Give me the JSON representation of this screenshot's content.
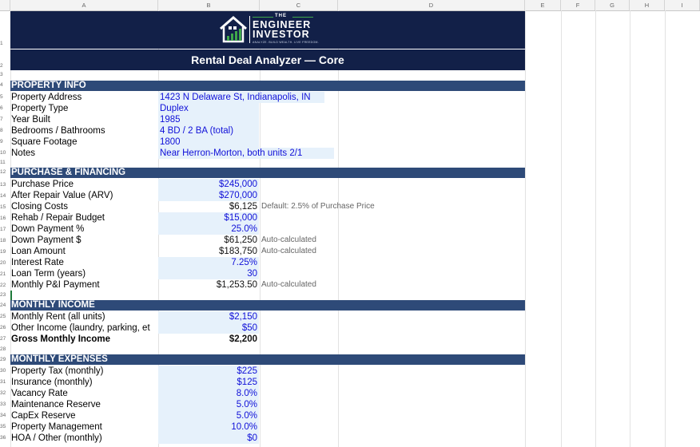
{
  "columns": [
    "A",
    "B",
    "C",
    "D",
    "E",
    "F",
    "G",
    "H",
    "I"
  ],
  "rows": [
    "1",
    "2",
    "3",
    "4",
    "5",
    "6",
    "7",
    "8",
    "9",
    "10",
    "11",
    "12",
    "13",
    "14",
    "15",
    "16",
    "17",
    "18",
    "19",
    "20",
    "21",
    "22",
    "23",
    "24",
    "25",
    "26",
    "27",
    "28",
    "29",
    "30",
    "31",
    "32",
    "33",
    "34",
    "35",
    "36"
  ],
  "logo": {
    "top": "THE",
    "line1": "ENGINEER",
    "line2": "INVESTOR",
    "tagline": "ANALYZE. BUILD WEALTH. LIVE FREEDOM."
  },
  "title": "Rental Deal Analyzer — Core",
  "property": {
    "header": "PROPERTY INFO",
    "rows": [
      {
        "label": "Property Address",
        "value": "1423 N Delaware St, Indianapolis, IN"
      },
      {
        "label": "Property Type",
        "value": "Duplex"
      },
      {
        "label": "Year Built",
        "value": "1985"
      },
      {
        "label": "Bedrooms / Bathrooms",
        "value": "4 BD / 2 BA (total)"
      },
      {
        "label": "Square Footage",
        "value": "1800"
      },
      {
        "label": "Notes",
        "value": "Near Herron-Morton, both units 2/1"
      }
    ]
  },
  "financing": {
    "header": "PURCHASE & FINANCING",
    "rows": [
      {
        "label": "Purchase Price",
        "value": "$245,000",
        "kind": "input",
        "note": ""
      },
      {
        "label": "After Repair Value (ARV)",
        "value": "$270,000",
        "kind": "input",
        "note": ""
      },
      {
        "label": "Closing Costs",
        "value": "$6,125",
        "kind": "calc",
        "note": "Default: 2.5% of Purchase Price"
      },
      {
        "label": "Rehab / Repair Budget",
        "value": "$15,000",
        "kind": "input",
        "note": ""
      },
      {
        "label": "Down Payment %",
        "value": "25.0%",
        "kind": "input",
        "note": ""
      },
      {
        "label": "Down Payment $",
        "value": "$61,250",
        "kind": "calc",
        "note": "Auto-calculated"
      },
      {
        "label": "Loan Amount",
        "value": "$183,750",
        "kind": "calc",
        "note": "Auto-calculated"
      },
      {
        "label": "Interest Rate",
        "value": "7.25%",
        "kind": "input",
        "note": ""
      },
      {
        "label": "Loan Term (years)",
        "value": "30",
        "kind": "input",
        "note": ""
      },
      {
        "label": "Monthly P&I Payment",
        "value": "$1,253.50",
        "kind": "calc",
        "note": "Auto-calculated"
      }
    ]
  },
  "income": {
    "header": "MONTHLY INCOME",
    "rows": [
      {
        "label": "Monthly Rent (all units)",
        "value": "$2,150"
      },
      {
        "label": "Other Income (laundry, parking, et",
        "value": "$50"
      }
    ],
    "total_label": "Gross Monthly Income",
    "total_value": "$2,200"
  },
  "expenses": {
    "header": "MONTHLY EXPENSES",
    "rows": [
      {
        "label": "Property Tax (monthly)",
        "value": "$225"
      },
      {
        "label": "Insurance (monthly)",
        "value": "$125"
      },
      {
        "label": "Vacancy Rate",
        "value": "8.0%"
      },
      {
        "label": "Maintenance Reserve",
        "value": "5.0%"
      },
      {
        "label": "CapEx Reserve",
        "value": "5.0%"
      },
      {
        "label": "Property Management",
        "value": "10.0%"
      },
      {
        "label": "HOA / Other (monthly)",
        "value": "$0"
      }
    ]
  },
  "colors": {
    "banner": "#122048",
    "section": "#2e4a78",
    "input_fill": "#e6f1fb",
    "input_text": "#1010d8",
    "accent": "#3fa84a"
  }
}
